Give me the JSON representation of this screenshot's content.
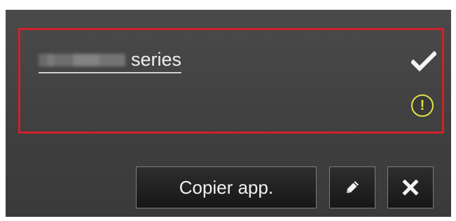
{
  "device": {
    "name_suffix": "series",
    "status_ok_icon": "checkmark-icon",
    "warning_icon": "warning-icon",
    "warning_symbol": "!",
    "warning_color": "#e2e24a",
    "selection_color": "#d0202a"
  },
  "actions": {
    "copy_label": "Copier app.",
    "edit_icon": "pencil-icon",
    "close_icon": "close-icon"
  }
}
